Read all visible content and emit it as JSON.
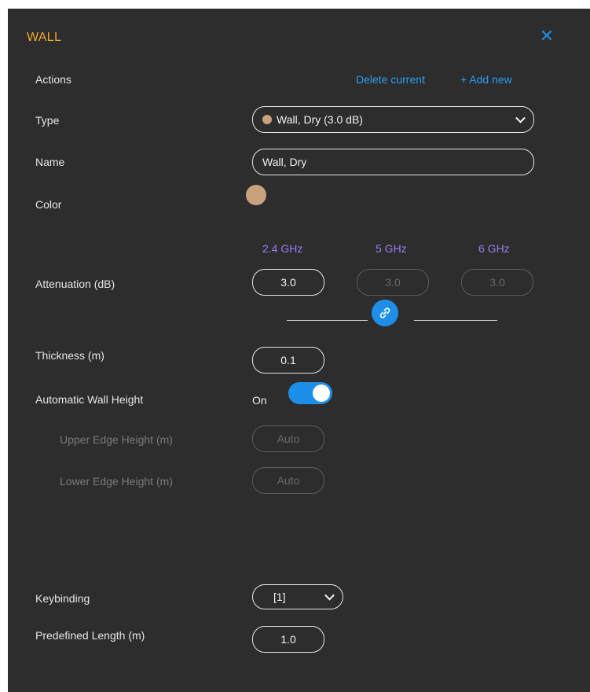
{
  "panel": {
    "title": "WALL",
    "close_icon": "close-icon",
    "accent_color": "#1e8fe8",
    "title_color": "#f0a830"
  },
  "actions": {
    "label": "Actions",
    "delete_label": "Delete current",
    "add_label": "+ Add new"
  },
  "type": {
    "label": "Type",
    "value": "Wall, Dry (3.0 dB)",
    "swatch_color": "#c8a27c"
  },
  "name": {
    "label": "Name",
    "value": "Wall, Dry"
  },
  "color": {
    "label": "Color",
    "value": "#c8a27c"
  },
  "attenuation": {
    "label": "Attenuation (dB)",
    "bands": [
      {
        "freq": "2.4 GHz",
        "value": "3.0",
        "enabled": true
      },
      {
        "freq": "5 GHz",
        "value": "3.0",
        "enabled": false
      },
      {
        "freq": "6 GHz",
        "value": "3.0",
        "enabled": false
      }
    ],
    "link_icon": "link-icon"
  },
  "thickness": {
    "label": "Thickness (m)",
    "value": "0.1"
  },
  "auto_height": {
    "label": "Automatic Wall Height",
    "state_label": "On",
    "on": true
  },
  "upper_edge": {
    "label": "Upper Edge Height (m)",
    "value": "Auto"
  },
  "lower_edge": {
    "label": "Lower Edge Height (m)",
    "value": "Auto"
  },
  "keybinding": {
    "label": "Keybinding",
    "value": "[1]"
  },
  "predefined_length": {
    "label": "Predefined Length (m)",
    "value": "1.0"
  }
}
